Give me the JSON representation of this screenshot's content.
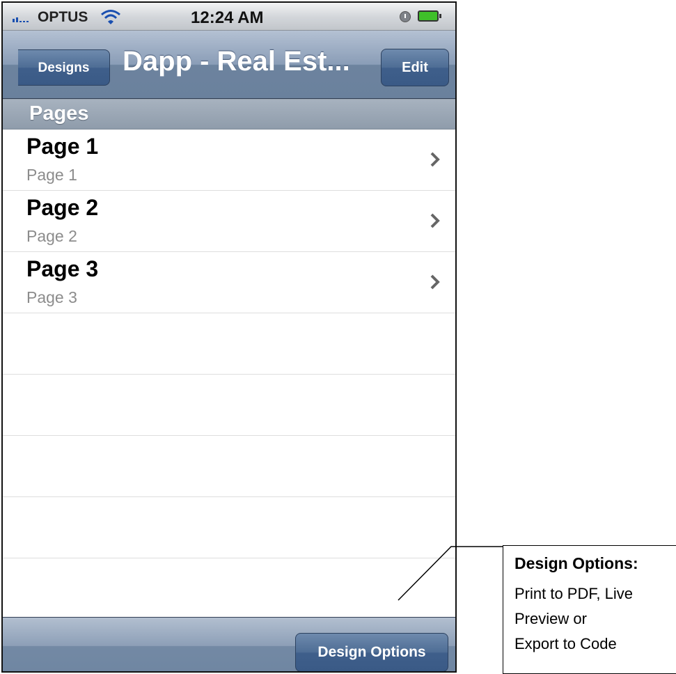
{
  "status_bar": {
    "carrier": "OPTUS",
    "time": "12:24 AM"
  },
  "nav_bar": {
    "back_label": "Designs",
    "title": "Dapp - Real Est...",
    "edit_label": "Edit"
  },
  "section_header": "Pages",
  "pages": [
    {
      "title": "Page 1",
      "subtitle": "Page 1"
    },
    {
      "title": "Page 2",
      "subtitle": "Page 2"
    },
    {
      "title": "Page 3",
      "subtitle": "Page 3"
    }
  ],
  "toolbar": {
    "design_options_label": "Design Options"
  },
  "callout": {
    "title": "Design Options:",
    "lines": [
      "Print to PDF, Live",
      "Preview or",
      "Export to Code"
    ]
  },
  "colors": {
    "nav_accent": "#6a819d",
    "button": "#3f5f8b",
    "battery": "#3fbf2a"
  }
}
